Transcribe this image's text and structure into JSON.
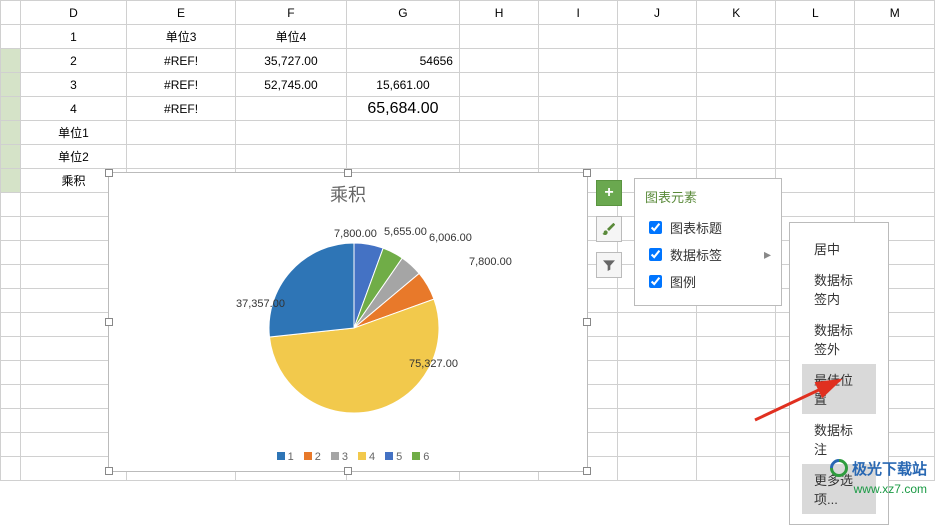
{
  "columns": [
    "D",
    "E",
    "F",
    "G",
    "H",
    "I",
    "J",
    "K",
    "L",
    "M"
  ],
  "rows": [
    {
      "D": "1",
      "E": "单位3",
      "F": "单位4",
      "G": "",
      "style": {
        "E": "bold",
        "F": "bold"
      }
    },
    {
      "D": "2",
      "E": "#REF!",
      "F": "35,727.00",
      "G": "54656",
      "style": {
        "E": "refErr",
        "G": "right"
      }
    },
    {
      "D": "3",
      "E": "#REF!",
      "F": "52,745.00",
      "G": "15,661.00",
      "style": {
        "E": "refErr"
      }
    },
    {
      "D": "4",
      "E": "#REF!",
      "F": "",
      "G": "65,684.00",
      "style": {
        "E": "refErr",
        "G": "big"
      }
    },
    {
      "D": "单位1",
      "style": {
        "D": "bold"
      }
    },
    {
      "D": "单位2",
      "style": {
        "D": "bold"
      }
    },
    {
      "D": "乘积",
      "style": {
        "D": "bold"
      }
    }
  ],
  "chart_data": {
    "type": "pie",
    "title": "乘积",
    "series_name": "",
    "categories": [
      "1",
      "2",
      "3",
      "4",
      "5",
      "6"
    ],
    "values": [
      7800,
      5655,
      6006,
      7800,
      75327,
      37357
    ],
    "labels": [
      "7,800.00",
      "5,655.00",
      "6,006.00",
      "7,800.00",
      "75,327.00",
      "37,357.00"
    ],
    "colors": [
      "#2E75B6",
      "#7AC143",
      "#F2C94C",
      "#C0504D",
      "#F2C94C",
      "#2E75B6"
    ],
    "legend_position": "bottom"
  },
  "side_buttons": {
    "plus": "+",
    "brush": "brush",
    "filter": "filter"
  },
  "popover1": {
    "title": "图表元素",
    "items": [
      {
        "label": "图表标题",
        "checked": true,
        "arrow": false
      },
      {
        "label": "数据标签",
        "checked": true,
        "arrow": true
      },
      {
        "label": "图例",
        "checked": true,
        "arrow": false
      }
    ]
  },
  "popover2": {
    "items": [
      {
        "label": "居中",
        "hl": false
      },
      {
        "label": "数据标签内",
        "hl": false
      },
      {
        "label": "数据标签外",
        "hl": false
      },
      {
        "label": "最佳位置",
        "hl": true
      },
      {
        "label": "数据标注",
        "hl": false
      },
      {
        "label": "更多选项...",
        "hl": true
      }
    ]
  },
  "watermark": {
    "name": "极光下载站",
    "url": "www.xz7.com"
  }
}
